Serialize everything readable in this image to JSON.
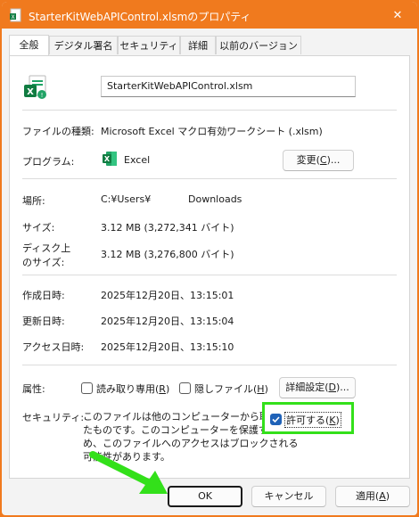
{
  "window": {
    "title": "StarterKitWebAPIControl.xlsmのプロパティ",
    "close_glyph": "✕"
  },
  "tabs": [
    {
      "label": "全般"
    },
    {
      "label": "デジタル署名"
    },
    {
      "label": "セキュリティ"
    },
    {
      "label": "詳細"
    },
    {
      "label": "以前のバージョン"
    }
  ],
  "general": {
    "file_name": "StarterKitWebAPIControl.xlsm",
    "file_type_label": "ファイルの種類:",
    "file_type_value": "Microsoft Excel マクロ有効ワークシート (.xlsm)",
    "program_label": "プログラム:",
    "program_value": "Excel",
    "change_button": {
      "prefix": "変更(",
      "key": "C",
      "suffix": ")..."
    },
    "location_label": "場所:",
    "location_prefix": "C:¥Users¥",
    "location_suffix": "Downloads",
    "size_label": "サイズ:",
    "size_value": "3.12 MB (3,272,341 バイト)",
    "disk_size_label_1": "ディスク上",
    "disk_size_label_2": "のサイズ:",
    "disk_size_value": "3.12 MB (3,276,800 バイト)",
    "created_label": "作成日時:",
    "created_value": "2025年12月20日、13:15:01",
    "modified_label": "更新日時:",
    "modified_value": "2025年12月20日、13:15:04",
    "accessed_label": "アクセス日時:",
    "accessed_value": "2025年12月20日、13:15:10",
    "attributes_label": "属性:",
    "readonly": {
      "prefix": "読み取り専用(",
      "key": "R",
      "suffix": ")",
      "checked": false
    },
    "hidden": {
      "prefix": "隠しファイル(",
      "key": "H",
      "suffix": ")",
      "checked": false
    },
    "advanced_button": {
      "prefix": "詳細設定(",
      "key": "D",
      "suffix": ")..."
    },
    "security_label": "セキュリティ:",
    "security_text_lines": [
      "このファイルは他のコンピューターから取得し",
      "たものです。このコンピューターを保護するた",
      "め、このファイルへのアクセスはブロックされる",
      "可能性があります。"
    ],
    "unblock": {
      "prefix": "許可する(",
      "key": "K",
      "suffix": ")",
      "checked": true
    }
  },
  "footer": {
    "ok_label": "OK",
    "cancel_label": "キャンセル",
    "apply": {
      "prefix": "適用(",
      "key": "A",
      "suffix": ")"
    }
  },
  "colors": {
    "titlebar": "#f07a1e",
    "highlight": "#33e01a",
    "excel_green": "#107c41",
    "checkbox_blue": "#1f62b8"
  },
  "icons": {
    "title": "file-properties-icon",
    "file": "excel-file-icon",
    "program": "excel-app-icon",
    "close": "close-icon"
  }
}
